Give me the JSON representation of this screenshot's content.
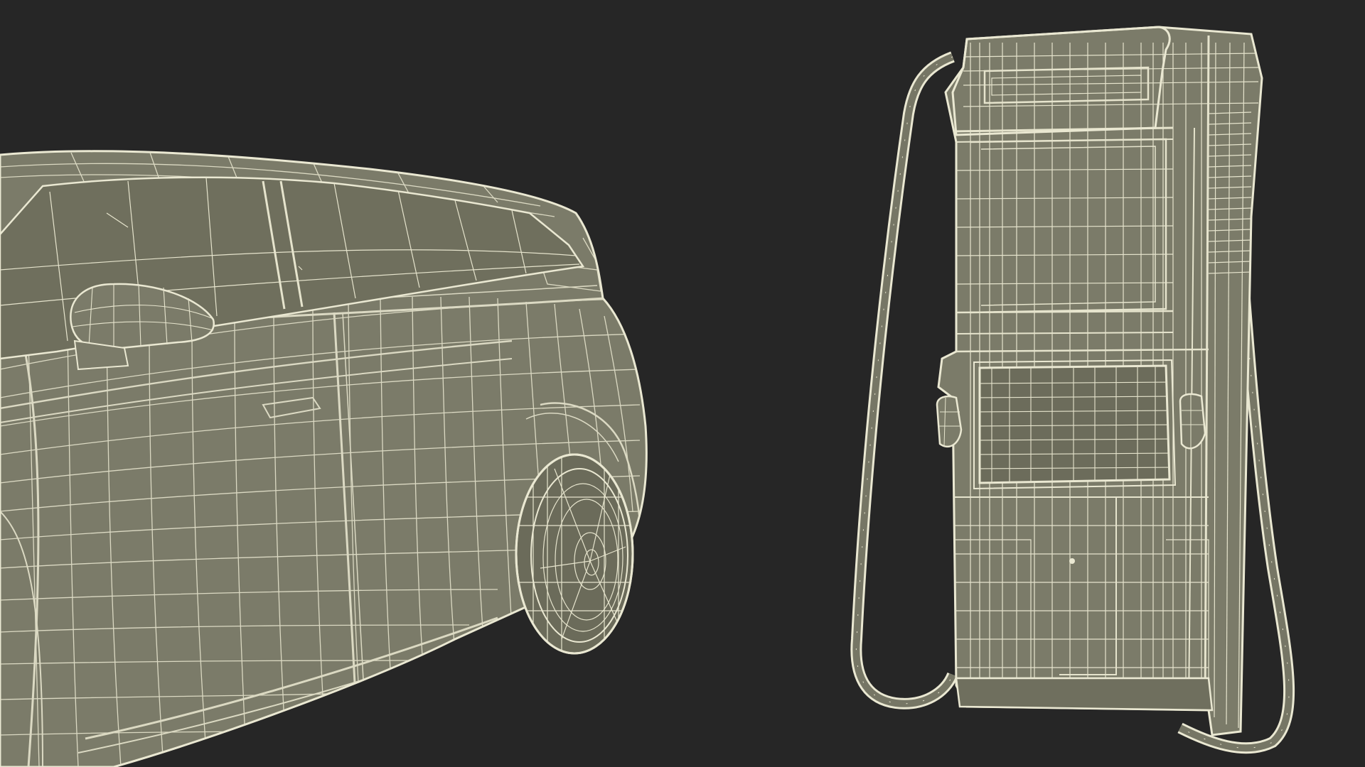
{
  "scene": {
    "background_color": "#262626",
    "surface_color": "#7c7c6a",
    "surface_dark_color": "#6d6d5c",
    "wire_color": "#eae8d2",
    "subjects": [
      "electric-car-wireframe",
      "ev-charging-station-wireframe"
    ]
  }
}
